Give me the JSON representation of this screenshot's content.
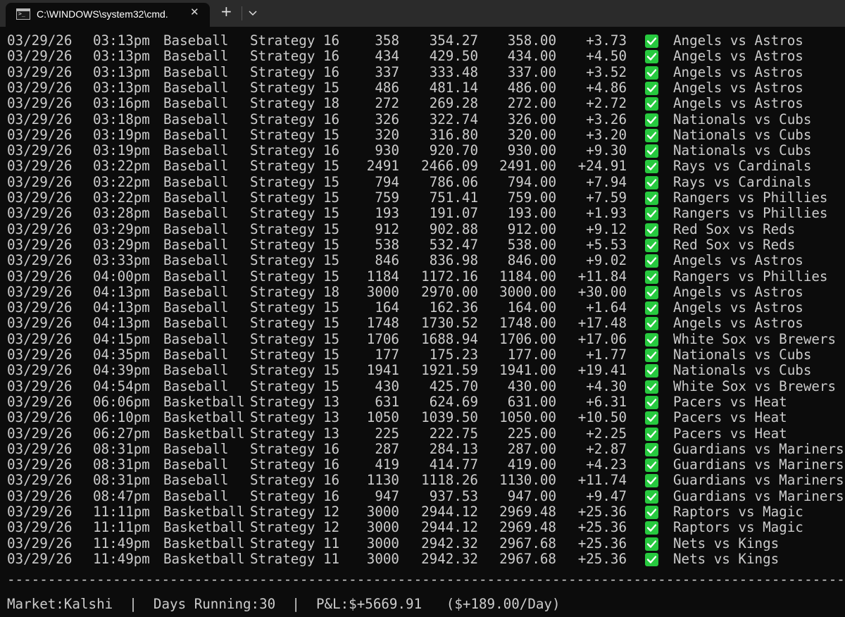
{
  "window": {
    "tab_title": "C:\\WINDOWS\\system32\\cmd.",
    "close_glyph": "✕",
    "new_tab_glyph": "+"
  },
  "trades": [
    {
      "date": "03/29/26",
      "time": "03:13pm",
      "sport": "Baseball",
      "strategy": "Strategy 16",
      "qty": "358",
      "cost": "354.27",
      "payout": "358.00",
      "pnl": "+3.73",
      "status": "win",
      "game": "Angels vs Astros"
    },
    {
      "date": "03/29/26",
      "time": "03:13pm",
      "sport": "Baseball",
      "strategy": "Strategy 16",
      "qty": "434",
      "cost": "429.50",
      "payout": "434.00",
      "pnl": "+4.50",
      "status": "win",
      "game": "Angels vs Astros"
    },
    {
      "date": "03/29/26",
      "time": "03:13pm",
      "sport": "Baseball",
      "strategy": "Strategy 16",
      "qty": "337",
      "cost": "333.48",
      "payout": "337.00",
      "pnl": "+3.52",
      "status": "win",
      "game": "Angels vs Astros"
    },
    {
      "date": "03/29/26",
      "time": "03:13pm",
      "sport": "Baseball",
      "strategy": "Strategy 15",
      "qty": "486",
      "cost": "481.14",
      "payout": "486.00",
      "pnl": "+4.86",
      "status": "win",
      "game": "Angels vs Astros"
    },
    {
      "date": "03/29/26",
      "time": "03:16pm",
      "sport": "Baseball",
      "strategy": "Strategy 18",
      "qty": "272",
      "cost": "269.28",
      "payout": "272.00",
      "pnl": "+2.72",
      "status": "win",
      "game": "Angels vs Astros"
    },
    {
      "date": "03/29/26",
      "time": "03:18pm",
      "sport": "Baseball",
      "strategy": "Strategy 16",
      "qty": "326",
      "cost": "322.74",
      "payout": "326.00",
      "pnl": "+3.26",
      "status": "win",
      "game": "Nationals vs Cubs"
    },
    {
      "date": "03/29/26",
      "time": "03:19pm",
      "sport": "Baseball",
      "strategy": "Strategy 15",
      "qty": "320",
      "cost": "316.80",
      "payout": "320.00",
      "pnl": "+3.20",
      "status": "win",
      "game": "Nationals vs Cubs"
    },
    {
      "date": "03/29/26",
      "time": "03:19pm",
      "sport": "Baseball",
      "strategy": "Strategy 16",
      "qty": "930",
      "cost": "920.70",
      "payout": "930.00",
      "pnl": "+9.30",
      "status": "win",
      "game": "Nationals vs Cubs"
    },
    {
      "date": "03/29/26",
      "time": "03:22pm",
      "sport": "Baseball",
      "strategy": "Strategy 15",
      "qty": "2491",
      "cost": "2466.09",
      "payout": "2491.00",
      "pnl": "+24.91",
      "status": "win",
      "game": "Rays vs Cardinals"
    },
    {
      "date": "03/29/26",
      "time": "03:22pm",
      "sport": "Baseball",
      "strategy": "Strategy 15",
      "qty": "794",
      "cost": "786.06",
      "payout": "794.00",
      "pnl": "+7.94",
      "status": "win",
      "game": "Rays vs Cardinals"
    },
    {
      "date": "03/29/26",
      "time": "03:22pm",
      "sport": "Baseball",
      "strategy": "Strategy 15",
      "qty": "759",
      "cost": "751.41",
      "payout": "759.00",
      "pnl": "+7.59",
      "status": "win",
      "game": "Rangers vs Phillies"
    },
    {
      "date": "03/29/26",
      "time": "03:28pm",
      "sport": "Baseball",
      "strategy": "Strategy 15",
      "qty": "193",
      "cost": "191.07",
      "payout": "193.00",
      "pnl": "+1.93",
      "status": "win",
      "game": "Rangers vs Phillies"
    },
    {
      "date": "03/29/26",
      "time": "03:29pm",
      "sport": "Baseball",
      "strategy": "Strategy 15",
      "qty": "912",
      "cost": "902.88",
      "payout": "912.00",
      "pnl": "+9.12",
      "status": "win",
      "game": "Red Sox vs Reds"
    },
    {
      "date": "03/29/26",
      "time": "03:29pm",
      "sport": "Baseball",
      "strategy": "Strategy 15",
      "qty": "538",
      "cost": "532.47",
      "payout": "538.00",
      "pnl": "+5.53",
      "status": "win",
      "game": "Red Sox vs Reds"
    },
    {
      "date": "03/29/26",
      "time": "03:33pm",
      "sport": "Baseball",
      "strategy": "Strategy 15",
      "qty": "846",
      "cost": "836.98",
      "payout": "846.00",
      "pnl": "+9.02",
      "status": "win",
      "game": "Angels vs Astros"
    },
    {
      "date": "03/29/26",
      "time": "04:00pm",
      "sport": "Baseball",
      "strategy": "Strategy 15",
      "qty": "1184",
      "cost": "1172.16",
      "payout": "1184.00",
      "pnl": "+11.84",
      "status": "win",
      "game": "Rangers vs Phillies"
    },
    {
      "date": "03/29/26",
      "time": "04:13pm",
      "sport": "Baseball",
      "strategy": "Strategy 18",
      "qty": "3000",
      "cost": "2970.00",
      "payout": "3000.00",
      "pnl": "+30.00",
      "status": "win",
      "game": "Angels vs Astros"
    },
    {
      "date": "03/29/26",
      "time": "04:13pm",
      "sport": "Baseball",
      "strategy": "Strategy 15",
      "qty": "164",
      "cost": "162.36",
      "payout": "164.00",
      "pnl": "+1.64",
      "status": "win",
      "game": "Angels vs Astros"
    },
    {
      "date": "03/29/26",
      "time": "04:13pm",
      "sport": "Baseball",
      "strategy": "Strategy 15",
      "qty": "1748",
      "cost": "1730.52",
      "payout": "1748.00",
      "pnl": "+17.48",
      "status": "win",
      "game": "Angels vs Astros"
    },
    {
      "date": "03/29/26",
      "time": "04:15pm",
      "sport": "Baseball",
      "strategy": "Strategy 15",
      "qty": "1706",
      "cost": "1688.94",
      "payout": "1706.00",
      "pnl": "+17.06",
      "status": "win",
      "game": "White Sox vs Brewers"
    },
    {
      "date": "03/29/26",
      "time": "04:35pm",
      "sport": "Baseball",
      "strategy": "Strategy 15",
      "qty": "177",
      "cost": "175.23",
      "payout": "177.00",
      "pnl": "+1.77",
      "status": "win",
      "game": "Nationals vs Cubs"
    },
    {
      "date": "03/29/26",
      "time": "04:39pm",
      "sport": "Baseball",
      "strategy": "Strategy 15",
      "qty": "1941",
      "cost": "1921.59",
      "payout": "1941.00",
      "pnl": "+19.41",
      "status": "win",
      "game": "Nationals vs Cubs"
    },
    {
      "date": "03/29/26",
      "time": "04:54pm",
      "sport": "Baseball",
      "strategy": "Strategy 15",
      "qty": "430",
      "cost": "425.70",
      "payout": "430.00",
      "pnl": "+4.30",
      "status": "win",
      "game": "White Sox vs Brewers"
    },
    {
      "date": "03/29/26",
      "time": "06:06pm",
      "sport": "Basketball",
      "strategy": "Strategy 13",
      "qty": "631",
      "cost": "624.69",
      "payout": "631.00",
      "pnl": "+6.31",
      "status": "win",
      "game": "Pacers vs Heat"
    },
    {
      "date": "03/29/26",
      "time": "06:10pm",
      "sport": "Basketball",
      "strategy": "Strategy 13",
      "qty": "1050",
      "cost": "1039.50",
      "payout": "1050.00",
      "pnl": "+10.50",
      "status": "win",
      "game": "Pacers vs Heat"
    },
    {
      "date": "03/29/26",
      "time": "06:27pm",
      "sport": "Basketball",
      "strategy": "Strategy 13",
      "qty": "225",
      "cost": "222.75",
      "payout": "225.00",
      "pnl": "+2.25",
      "status": "win",
      "game": "Pacers vs Heat"
    },
    {
      "date": "03/29/26",
      "time": "08:31pm",
      "sport": "Baseball",
      "strategy": "Strategy 16",
      "qty": "287",
      "cost": "284.13",
      "payout": "287.00",
      "pnl": "+2.87",
      "status": "win",
      "game": "Guardians vs Mariners"
    },
    {
      "date": "03/29/26",
      "time": "08:31pm",
      "sport": "Baseball",
      "strategy": "Strategy 16",
      "qty": "419",
      "cost": "414.77",
      "payout": "419.00",
      "pnl": "+4.23",
      "status": "win",
      "game": "Guardians vs Mariners"
    },
    {
      "date": "03/29/26",
      "time": "08:31pm",
      "sport": "Baseball",
      "strategy": "Strategy 16",
      "qty": "1130",
      "cost": "1118.26",
      "payout": "1130.00",
      "pnl": "+11.74",
      "status": "win",
      "game": "Guardians vs Mariners"
    },
    {
      "date": "03/29/26",
      "time": "08:47pm",
      "sport": "Baseball",
      "strategy": "Strategy 16",
      "qty": "947",
      "cost": "937.53",
      "payout": "947.00",
      "pnl": "+9.47",
      "status": "win",
      "game": "Guardians vs Mariners"
    },
    {
      "date": "03/29/26",
      "time": "11:11pm",
      "sport": "Basketball",
      "strategy": "Strategy 12",
      "qty": "3000",
      "cost": "2944.12",
      "payout": "2969.48",
      "pnl": "+25.36",
      "status": "win",
      "game": "Raptors vs Magic"
    },
    {
      "date": "03/29/26",
      "time": "11:11pm",
      "sport": "Basketball",
      "strategy": "Strategy 12",
      "qty": "3000",
      "cost": "2944.12",
      "payout": "2969.48",
      "pnl": "+25.36",
      "status": "win",
      "game": "Raptors vs Magic"
    },
    {
      "date": "03/29/26",
      "time": "11:49pm",
      "sport": "Basketball",
      "strategy": "Strategy 11",
      "qty": "3000",
      "cost": "2942.32",
      "payout": "2967.68",
      "pnl": "+25.36",
      "status": "win",
      "game": "Nets vs Kings"
    },
    {
      "date": "03/29/26",
      "time": "11:49pm",
      "sport": "Basketball",
      "strategy": "Strategy 11",
      "qty": "3000",
      "cost": "2942.32",
      "payout": "2967.68",
      "pnl": "+25.36",
      "status": "win",
      "game": "Nets vs Kings"
    }
  ],
  "separator": "-----------------------------------------------------------------------------------------------------------------",
  "footer": "Market:Kalshi  |  Days Running:30  |  P&L:$+5669.91   ($+189.00/Day)",
  "colors": {
    "background": "#0c0c0c",
    "text": "#cccccc",
    "check": "#27c93f",
    "tabbar": "#2b2b2b"
  },
  "icons": {
    "tab": "cmd-icon",
    "close": "close-icon",
    "new_tab": "plus-icon",
    "dropdown": "chevron-down-icon",
    "status_win": "check-box-icon"
  }
}
